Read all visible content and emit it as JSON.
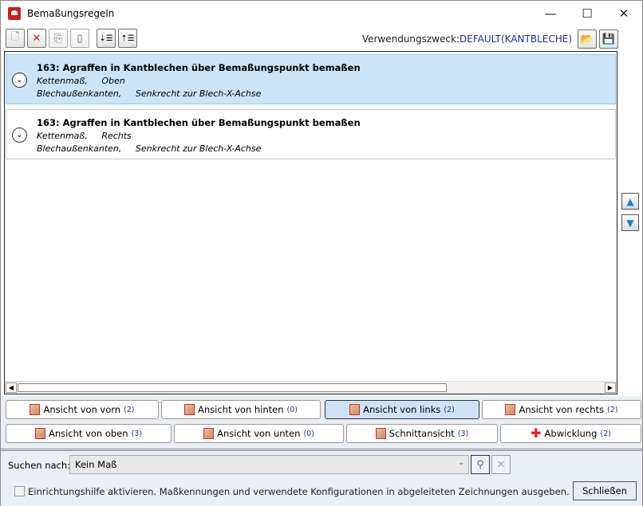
{
  "window": {
    "title": "Bemaßungsregeln",
    "minimize": "—",
    "maximize": "☐",
    "close": "✕"
  },
  "toolbar": {
    "purpose_label": "Verwendungszweck:",
    "purpose_value": "DEFAULT(KANTBLECHE)"
  },
  "rules": [
    {
      "title": "163: Agraffen in Kantblechen über Bemaßungspunkt bemaßen",
      "line2": "Kettenmaß,     Oben",
      "line3": "Blechaußenkanten,     Senkrecht zur Blech-X-Achse",
      "selected": true
    },
    {
      "title": "163: Agraffen in Kantblechen über Bemaßungspunkt bemaßen",
      "line2": "Kettenmaß,     Rechts",
      "line3": "Blechaußenkanten,     Senkrecht zur Blech-X-Achse",
      "selected": false
    }
  ],
  "views": [
    {
      "label": "Ansicht von vorn",
      "count": "(2)"
    },
    {
      "label": "Ansicht von hinten",
      "count": "(0)"
    },
    {
      "label": "Ansicht von links",
      "count": "(2)",
      "active": true
    },
    {
      "label": "Ansicht von rechts",
      "count": "(2)"
    },
    {
      "label": "Ansicht von oben",
      "count": "(3)"
    },
    {
      "label": "Ansicht von unten",
      "count": "(0)"
    },
    {
      "label": "Schnittansicht",
      "count": "(3)"
    },
    {
      "label": "Abwicklung",
      "count": "(2)"
    }
  ],
  "search": {
    "label": "Suchen nach:",
    "value": "Kein Maß"
  },
  "footer": {
    "checkbox_label": "Einrichtungshilfe aktivieren. Maßkennungen und verwendete Konfigurationen in abgeleiteten Zeichnungen ausgeben.",
    "close_label": "Schließen"
  }
}
